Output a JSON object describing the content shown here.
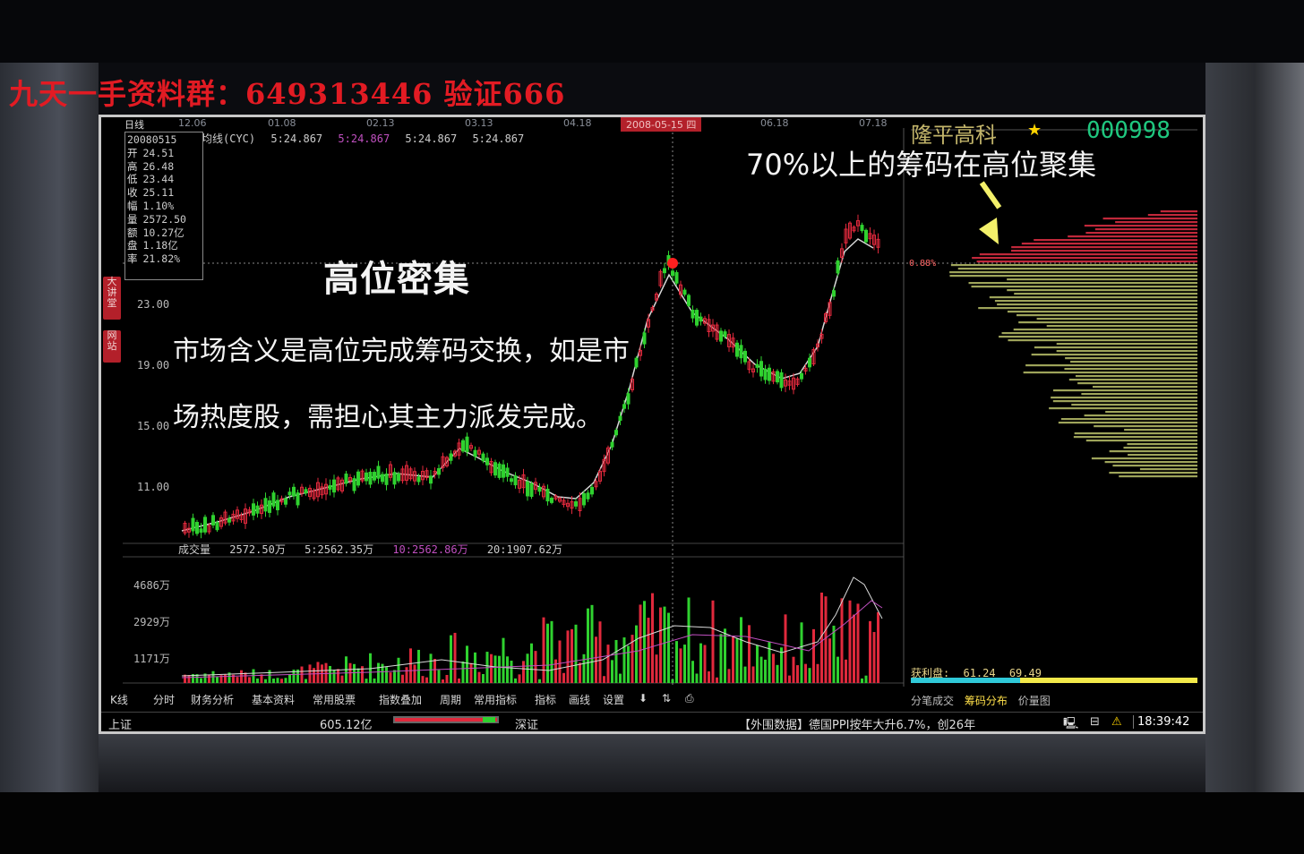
{
  "watermark": "九天一手资料群：649313446 验证666",
  "date_bar": {
    "left_label": "日线",
    "dates": [
      "12.06",
      "01.08",
      "02.13",
      "03.13",
      "04.18",
      "06.18",
      "07.18"
    ],
    "cursor_date": "2008-05-15 四"
  },
  "ma_line": {
    "label": "均线(CYC)",
    "values": [
      "5:24.867",
      "5:24.867",
      "5:24.867",
      "5:24.867"
    ]
  },
  "info_box": {
    "date": "20080515",
    "rows": [
      {
        "label": "开",
        "value": "24.51"
      },
      {
        "label": "高",
        "value": "26.48"
      },
      {
        "label": "低",
        "value": "23.44"
      },
      {
        "label": "收",
        "value": "25.11"
      },
      {
        "label": "幅",
        "value": "1.10%"
      },
      {
        "label": "量",
        "value": "2572.50"
      },
      {
        "label": "额",
        "value": "10.27亿"
      },
      {
        "label": "盘",
        "value": "1.18亿"
      },
      {
        "label": "率",
        "value": "21.82%"
      }
    ]
  },
  "side_tabs": [
    "大讲堂",
    "网站"
  ],
  "price_axis": [
    "23.00",
    "19.00",
    "15.00",
    "11.00"
  ],
  "volume_axis": [
    "4686万",
    "2929万",
    "1171万"
  ],
  "volume_header": {
    "label": "成交量",
    "value": "2572.50万",
    "ma5": "5:2562.35万",
    "ma10": "10:2562.86万",
    "ma20": "20:1907.62万"
  },
  "overlay": {
    "title": "高位密集",
    "desc_line1": "市场含义是高位完成筹码交换，如是市",
    "desc_line2": "场热度股，需担心其主力派发完成。",
    "annotation": "70%以上的筹码在高位聚集"
  },
  "stock": {
    "name": "隆平高科",
    "code": "000998"
  },
  "chip_panel": {
    "price_mark": "0.88%",
    "profit_label": "获利盘:",
    "profit_values": [
      "61.24",
      "69.49"
    ],
    "tabs": [
      "分笔成交",
      "筹码分布",
      "价量图"
    ],
    "active_tab": "筹码分布"
  },
  "toolbar": [
    "K线",
    "分时",
    "财务分析",
    "基本资料",
    "常用股票",
    "指数叠加",
    "周期",
    "常用指标",
    "指标",
    "画线",
    "设置"
  ],
  "statusbar": {
    "sh_label": "上证",
    "sh_amount": "605.12亿",
    "sz_label": "深证",
    "news": "【外围数据】德国PPI按年大升6.7%，创26年",
    "time": "18:39:42"
  },
  "colors": {
    "up": "#e0293c",
    "down": "#2fd12f",
    "chip_high": "#c0283a",
    "chip_low": "#9ea45a"
  }
}
